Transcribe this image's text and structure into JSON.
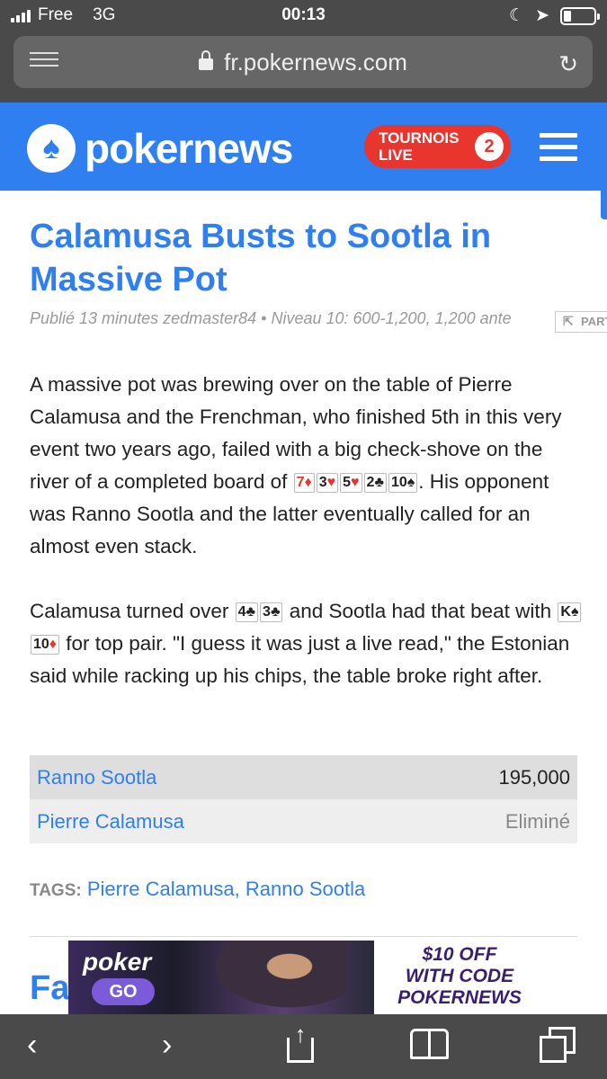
{
  "status_bar": {
    "carrier": "Free",
    "network": "3G",
    "time": "00:13"
  },
  "browser": {
    "url": "fr.pokernews.com"
  },
  "header": {
    "logo_text": "pokernews",
    "live_label_line1": "TOURNOIS",
    "live_label_line2": "LIVE",
    "live_count": "2"
  },
  "article": {
    "title": "Calamusa Busts to Sootla in Massive Pot",
    "meta": "Publié 13 minutes zedmaster84 • Niveau 10: 600-1,200, 1,200 ante",
    "share_label": "PART",
    "p1_text1": "A massive pot was brewing over on the table of Pierre Calamusa and the Frenchman, who finished 5th in this very event two years ago, failed with a big check-shove on the river of a completed board of ",
    "p1_text2": ". His opponent was Ranno Sootla and the latter eventually called for an almost even stack.",
    "board_cards": [
      {
        "rank": "7",
        "suit": "♦",
        "color": "red"
      },
      {
        "rank": "3",
        "suit": "♥",
        "color": "red"
      },
      {
        "rank": "5",
        "suit": "♥",
        "color": "red"
      },
      {
        "rank": "2",
        "suit": "♣",
        "color": "black"
      },
      {
        "rank": "10",
        "suit": "♠",
        "color": "black"
      }
    ],
    "p2_text1": "Calamusa turned over ",
    "p2_text2": " and Sootla had that beat with ",
    "p2_text3": " for top pair. \"I guess it was just a live read,\" the Estonian said while racking up his chips, the table broke right after.",
    "calamusa_cards": [
      {
        "rank": "4",
        "suit": "♣",
        "color": "black"
      },
      {
        "rank": "3",
        "suit": "♣",
        "color": "black"
      }
    ],
    "sootla_cards": [
      {
        "rank": "K",
        "suit": "♠",
        "color": "black"
      },
      {
        "rank": "10",
        "suit": "♦",
        "color": "red"
      }
    ]
  },
  "results": [
    {
      "player": "Ranno Sootla",
      "amount": "195,000"
    },
    {
      "player": "Pierre Calamusa",
      "amount": "Eliminé"
    }
  ],
  "tags": {
    "label": "TAGS:",
    "links": "Pierre Calamusa, Ranno Sootla"
  },
  "next_heading": "Fa",
  "ad": {
    "brand_top": "poker",
    "brand_bottom": "GO",
    "line1": "$10 OFF",
    "line2": "WITH CODE",
    "line3": "POKERNEWS"
  },
  "colors": {
    "brand_blue": "#2f7ff0",
    "live_red": "#e8362f",
    "chrome_gray": "#4a4a4a"
  }
}
